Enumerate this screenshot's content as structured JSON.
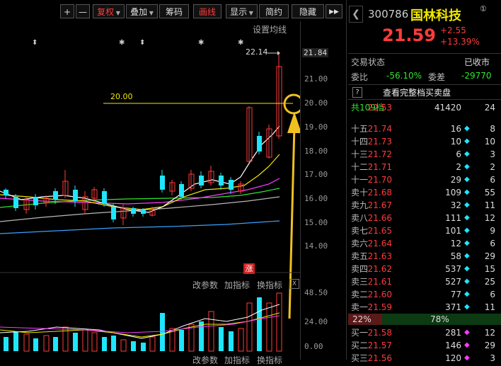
{
  "toolbar": {
    "plus": "+",
    "minus": "—",
    "fuquan": "复权",
    "diejia": "叠加",
    "chouma": "筹码",
    "huaxian": "画线",
    "xianshi": "显示",
    "jianyue": "简约",
    "yincang": "隐藏",
    "expand": "▶▶"
  },
  "chart": {
    "settings_link": "设置均线",
    "y_labels": [
      "21.84",
      "21.00",
      "20.00",
      "19.00",
      "18.00",
      "17.00",
      "16.00",
      "15.00",
      "14.00"
    ],
    "peak_label": "22.14",
    "hline_label": "20.00",
    "zhang_badge": "涨",
    "vol_links": {
      "params": "改参数",
      "add": "加指标",
      "switch": "换指标",
      "close": "X"
    },
    "vol_labels": [
      "48.50",
      "24.00",
      "0.00"
    ],
    "bottom_links": {
      "params": "改参数",
      "add": "加指标",
      "switch": "换指标"
    },
    "colors": {
      "up": "#ff3b3b",
      "down": "#1ee6ff",
      "ma5": "#ffffff",
      "ma10": "#f0e800",
      "ma20": "#ff3bff",
      "ma30": "#2ee52e",
      "ma60": "#b0b0b0",
      "ma120": "#3aa0ff",
      "annotation": "#f0c020"
    }
  },
  "quote": {
    "code": "300786",
    "name": "国林科技",
    "circle": "①",
    "price": "21.59",
    "change": "+2.55",
    "change_pct": "+13.39%",
    "status_label": "交易状态",
    "status_value": "已收市",
    "weibi_label": "委比",
    "weibi_value": "-56.10%",
    "weicha_label": "委差",
    "weicha_value": "-29770",
    "full_book": "查看完整档买卖盘",
    "total_label": "共109档",
    "total_price": "22.53",
    "total_vol": "41420",
    "total_cnt": "24",
    "sell_rows": [
      {
        "label": "十五",
        "price": "21.74",
        "vol": "16",
        "dot": "◆",
        "cnt": "8"
      },
      {
        "label": "十四",
        "price": "21.73",
        "vol": "10",
        "dot": "◆",
        "cnt": "10"
      },
      {
        "label": "十三",
        "price": "21.72",
        "vol": "6",
        "dot": "◆",
        "cnt": "3"
      },
      {
        "label": "十二",
        "price": "21.71",
        "vol": "2",
        "dot": "◆",
        "cnt": "2"
      },
      {
        "label": "十一",
        "price": "21.70",
        "vol": "29",
        "dot": "◆",
        "cnt": "6"
      },
      {
        "label": "卖十",
        "price": "21.68",
        "vol": "109",
        "dot": "◆",
        "cnt": "55"
      },
      {
        "label": "卖九",
        "price": "21.67",
        "vol": "32",
        "dot": "◆",
        "cnt": "11"
      },
      {
        "label": "卖八",
        "price": "21.66",
        "vol": "111",
        "dot": "◆",
        "cnt": "12"
      },
      {
        "label": "卖七",
        "price": "21.65",
        "vol": "101",
        "dot": "◆",
        "cnt": "9"
      },
      {
        "label": "卖六",
        "price": "21.64",
        "vol": "12",
        "dot": "◆",
        "cnt": "6"
      },
      {
        "label": "卖五",
        "price": "21.63",
        "vol": "58",
        "dot": "◆",
        "cnt": "29"
      },
      {
        "label": "卖四",
        "price": "21.62",
        "vol": "537",
        "dot": "◆",
        "cnt": "15"
      },
      {
        "label": "卖三",
        "price": "21.61",
        "vol": "527",
        "dot": "◆",
        "cnt": "25"
      },
      {
        "label": "卖二",
        "price": "21.60",
        "vol": "77",
        "dot": "◆",
        "cnt": "6"
      },
      {
        "label": "卖一",
        "price": "21.59",
        "vol": "371",
        "dot": "◆",
        "cnt": "11"
      }
    ],
    "ratio_sell": "22%",
    "ratio_buy": "78%",
    "buy_rows": [
      {
        "label": "买一",
        "price": "21.58",
        "vol": "281",
        "dot": "◆",
        "cnt": "12"
      },
      {
        "label": "买二",
        "price": "21.57",
        "vol": "146",
        "dot": "◆",
        "cnt": "29"
      },
      {
        "label": "买三",
        "price": "21.56",
        "vol": "120",
        "dot": "◆",
        "cnt": "3"
      }
    ]
  }
}
